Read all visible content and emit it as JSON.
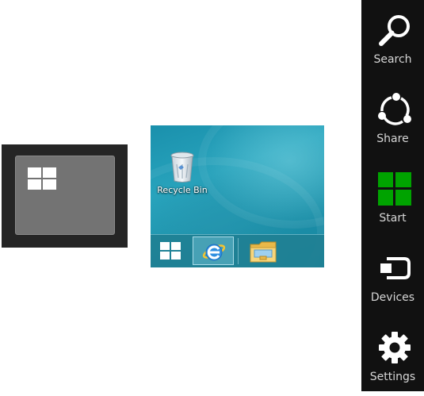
{
  "start_tooltip": {
    "icon": "windows-logo-icon"
  },
  "desktop": {
    "recycle_bin": {
      "label": "Recycle Bin",
      "icon": "recycle-bin-icon"
    },
    "taskbar": {
      "start_icon": "windows-logo-icon",
      "pinned": [
        {
          "name": "Internet Explorer",
          "icon": "ie-icon",
          "active": true
        },
        {
          "name": "File Explorer",
          "icon": "folder-icon",
          "active": false
        }
      ]
    }
  },
  "charms": [
    {
      "label": "Search",
      "icon": "search-icon"
    },
    {
      "label": "Share",
      "icon": "share-icon"
    },
    {
      "label": "Start",
      "icon": "windows-start-icon"
    },
    {
      "label": "Devices",
      "icon": "devices-icon"
    },
    {
      "label": "Settings",
      "icon": "gear-icon"
    }
  ],
  "colors": {
    "charms_bg": "#111111",
    "charm_icon": "#ffffff",
    "start_green": "#00a300",
    "desktop_teal": "#1a90ac"
  }
}
